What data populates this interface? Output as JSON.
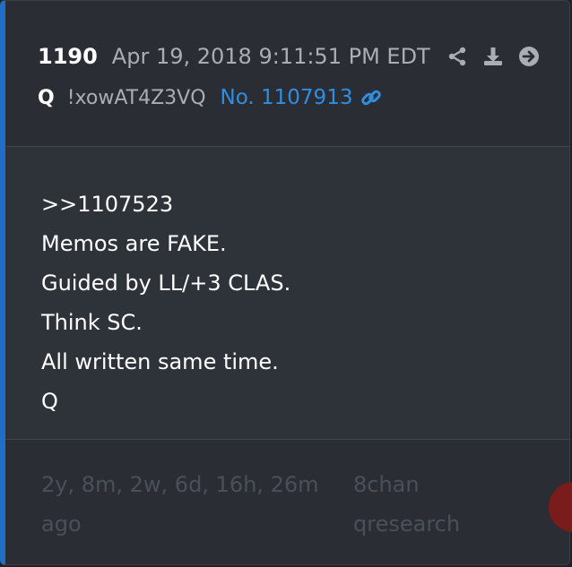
{
  "header": {
    "post_number": "1190",
    "timestamp": "Apr 19, 2018 9:11:51 PM EDT",
    "author": "Q",
    "tripcode": "!xowAT4Z3VQ",
    "post_link": "No. 1107913",
    "icons": [
      "share-icon",
      "download-icon",
      "forward-icon",
      "link-icon"
    ]
  },
  "body": {
    "lines": [
      ">>1107523",
      "Memos are FAKE.",
      "Guided by LL/+3 CLAS.",
      "Think SC.",
      "All written same time.",
      "Q"
    ]
  },
  "footer": {
    "relative_time": "2y, 8m, 2w, 6d, 16h, 26m ago",
    "source": "8chan qresearch"
  },
  "colors": {
    "accent": "#1f6fc4",
    "link": "#2f8ee0",
    "icon": "#a9aeb5",
    "muted": "#4a5058"
  }
}
